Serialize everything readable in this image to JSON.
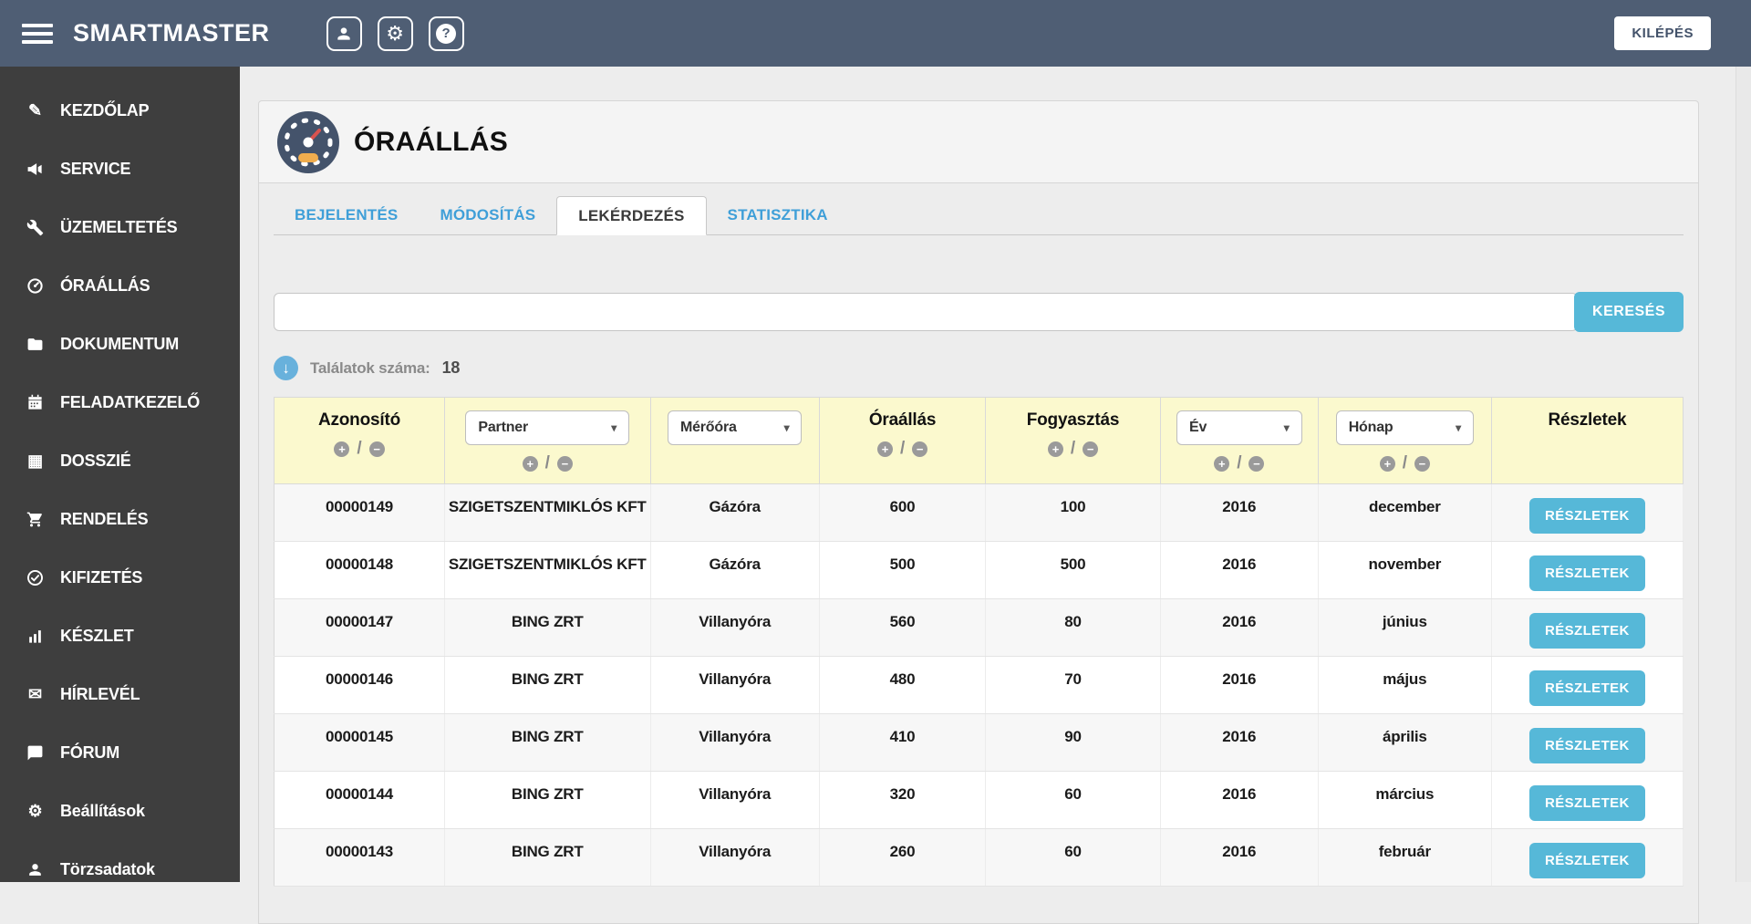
{
  "colors": {
    "topbar": "#4f5e74",
    "sidebar": "#3e3e3e",
    "accent": "#56b8d8",
    "accent_text": "#3f9fd8",
    "table_header_bg": "#fbf9ce",
    "alert_red": "#e21d1d"
  },
  "topbar": {
    "brand": "SMARTMASTER",
    "logout_label": "KILÉPÉS",
    "icons": [
      {
        "name": "user-icon"
      },
      {
        "name": "settings-icon"
      },
      {
        "name": "help-icon"
      }
    ]
  },
  "sidebar": {
    "items": [
      {
        "label": "KEZDŐLAP",
        "icon": "edit"
      },
      {
        "label": "SERVICE",
        "icon": "megaphone"
      },
      {
        "label": "ÜZEMELTETÉS",
        "icon": "wrench"
      },
      {
        "label": "ÓRAÁLLÁS",
        "icon": "gauge"
      },
      {
        "label": "DOKUMENTUM",
        "icon": "folder"
      },
      {
        "label": "FELADATKEZELŐ",
        "icon": "calendar"
      },
      {
        "label": "DOSSZIÉ",
        "icon": "grid"
      },
      {
        "label": "RENDELÉS",
        "icon": "cart"
      },
      {
        "label": "KIFIZETÉS",
        "icon": "check-circle"
      },
      {
        "label": "KÉSZLET",
        "icon": "bar-chart"
      },
      {
        "label": "HÍRLEVÉL",
        "icon": "envelope"
      },
      {
        "label": "FÓRUM",
        "icon": "comment"
      },
      {
        "label": "Beállítások",
        "icon": "gear"
      },
      {
        "label": "Törzsadatok",
        "icon": "person"
      }
    ]
  },
  "page": {
    "title": "ÓRAÁLLÁS",
    "title_icon": "gauge-badge-icon",
    "tabs": [
      {
        "label": "BEJELENTÉS",
        "active": false
      },
      {
        "label": "MÓDOSÍTÁS",
        "active": false
      },
      {
        "label": "LEKÉRDEZÉS",
        "active": true
      },
      {
        "label": "STATISZTIKA",
        "active": false
      }
    ],
    "search": {
      "value": "",
      "button_label": "KERESÉS"
    },
    "results": {
      "label": "Találatok száma:",
      "count": "18"
    }
  },
  "table": {
    "columns": [
      {
        "key": "id",
        "label": "Azonosító",
        "type": "sort",
        "width": "12.1%"
      },
      {
        "key": "partner",
        "label": "Partner",
        "type": "select-sort",
        "width": "14.6%"
      },
      {
        "key": "meter",
        "label": "Mérőóra",
        "type": "select",
        "width": "12.0%"
      },
      {
        "key": "reading",
        "label": "Óraállás",
        "type": "sort",
        "width": "11.8%"
      },
      {
        "key": "consumption",
        "label": "Fogyasztás",
        "type": "sort",
        "width": "12.4%"
      },
      {
        "key": "year",
        "label": "Év",
        "type": "select-sort",
        "width": "11.2%"
      },
      {
        "key": "month",
        "label": "Hónap",
        "type": "select-sort",
        "width": "12.3%"
      },
      {
        "key": "details",
        "label": "Részletek",
        "type": "plain",
        "width": "13.6%"
      }
    ],
    "sort_plus": "+",
    "sort_minus": "−",
    "details_button_label": "RÉSZLETEK",
    "rows": [
      {
        "id": "00000149",
        "id_red": false,
        "partner": "SZIGETSZENTMIKLÓS KFT",
        "meter": "Gázóra",
        "reading": "600",
        "consumption": "100",
        "year": "2016",
        "month": "december"
      },
      {
        "id": "00000148",
        "id_red": false,
        "partner": "SZIGETSZENTMIKLÓS KFT",
        "meter": "Gázóra",
        "reading": "500",
        "consumption": "500",
        "year": "2016",
        "month": "november"
      },
      {
        "id": "00000147",
        "id_red": false,
        "partner": "BING ZRT",
        "meter": "Villanyóra",
        "reading": "560",
        "consumption": "80",
        "year": "2016",
        "month": "június"
      },
      {
        "id": "00000146",
        "id_red": false,
        "partner": "BING ZRT",
        "meter": "Villanyóra",
        "reading": "480",
        "consumption": "70",
        "year": "2016",
        "month": "május"
      },
      {
        "id": "00000145",
        "id_red": false,
        "partner": "BING ZRT",
        "meter": "Villanyóra",
        "reading": "410",
        "consumption": "90",
        "year": "2016",
        "month": "április"
      },
      {
        "id": "00000144",
        "id_red": true,
        "partner": "BING ZRT",
        "meter": "Villanyóra",
        "reading": "320",
        "consumption": "60",
        "year": "2016",
        "month": "március"
      },
      {
        "id": "00000143",
        "id_red": false,
        "partner": "BING ZRT",
        "meter": "Villanyóra",
        "reading": "260",
        "consumption": "60",
        "year": "2016",
        "month": "február"
      }
    ]
  }
}
